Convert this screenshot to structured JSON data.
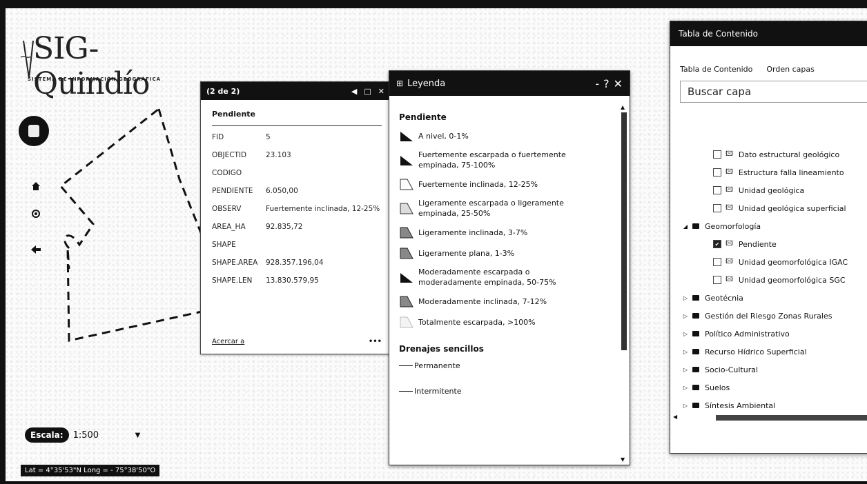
{
  "logo": {
    "title": "SIG-Quindío",
    "subtitle": "SISTEMA DE INFORMACIÓN GEOGRÁFICA"
  },
  "popup": {
    "counter": "(2 de 2)",
    "title": "Pendiente",
    "attributes": [
      {
        "key": "FID",
        "value": "5"
      },
      {
        "key": "OBJECTID",
        "value": "23.103"
      },
      {
        "key": "CODIGO",
        "value": ""
      },
      {
        "key": "PENDIENTE",
        "value": "6.050,00"
      },
      {
        "key": "OBSERV",
        "value": "Fuertemente inclinada, 12-25%"
      },
      {
        "key": "AREA_HA",
        "value": "92.835,72"
      },
      {
        "key": "SHAPE",
        "value": ""
      },
      {
        "key": "SHAPE.AREA",
        "value": "928.357.196,04"
      },
      {
        "key": "SHAPE.LEN",
        "value": "13.830.579,95"
      }
    ],
    "zoom_link": "Acercar a",
    "more": "•••"
  },
  "legend": {
    "title": "Leyenda",
    "controls": {
      "min": "-",
      "help": "?",
      "close": "✕"
    },
    "section1": "Pendiente",
    "items": [
      {
        "label": "A nivel, 0-1%",
        "style": "solid"
      },
      {
        "label": "Fuertemente escarpada o fuertemente empinada, 75-100%",
        "style": "solid"
      },
      {
        "label": "Fuertemente inclinada, 12-25%",
        "style": "outline"
      },
      {
        "label": "Ligeramente escarpada o ligeramente empinada, 25-50%",
        "style": "dotted"
      },
      {
        "label": "Ligeramente inclinada, 3-7%",
        "style": "hatched"
      },
      {
        "label": "Ligeramente plana, 1-3%",
        "style": "hatched"
      },
      {
        "label": "Moderadamente escarpada o moderadamente empinada, 50-75%",
        "style": "solid"
      },
      {
        "label": "Moderadamente inclinada, 7-12%",
        "style": "hatched"
      },
      {
        "label": "Totalmente escarpada, >100%",
        "style": "light"
      }
    ],
    "section2": "Drenajes sencillos",
    "lines": [
      {
        "label": "Permanente"
      },
      {
        "label": "Intermitente"
      }
    ]
  },
  "toc": {
    "title": "Tabla de Contenido",
    "tabs": [
      "Tabla de Contenido",
      "Orden capas"
    ],
    "search_placeholder": "Buscar capa",
    "rows": [
      {
        "type": "layer",
        "label": "Dato estructural geológico",
        "checked": false
      },
      {
        "type": "layer",
        "label": "Estructura falla lineamiento",
        "checked": false
      },
      {
        "type": "layer",
        "label": "Unidad geológica",
        "checked": false
      },
      {
        "type": "layer",
        "label": "Unidad geológica superficial",
        "checked": false
      },
      {
        "type": "group",
        "label": "Geomorfología",
        "expanded": true
      },
      {
        "type": "layer",
        "label": "Pendiente",
        "checked": true
      },
      {
        "type": "layer",
        "label": "Unidad geomorfológica IGAC",
        "checked": false
      },
      {
        "type": "layer",
        "label": "Unidad geomorfológica SGC",
        "checked": false
      },
      {
        "type": "group",
        "label": "Geotécnia",
        "expanded": false
      },
      {
        "type": "group",
        "label": "Gestión del Riesgo Zonas Rurales",
        "expanded": false
      },
      {
        "type": "group",
        "label": "Político Administrativo",
        "expanded": false
      },
      {
        "type": "group",
        "label": "Recurso Hídrico Superficial",
        "expanded": false
      },
      {
        "type": "group",
        "label": "Socio-Cultural",
        "expanded": false
      },
      {
        "type": "group",
        "label": "Suelos",
        "expanded": false
      },
      {
        "type": "group",
        "label": "Síntesis Ambiental",
        "expanded": false
      }
    ]
  },
  "scale": {
    "label": "Escala:",
    "value": "1:500"
  },
  "coords": "Lat = 4°35'53\"N Long = - 75°38'50\"O"
}
